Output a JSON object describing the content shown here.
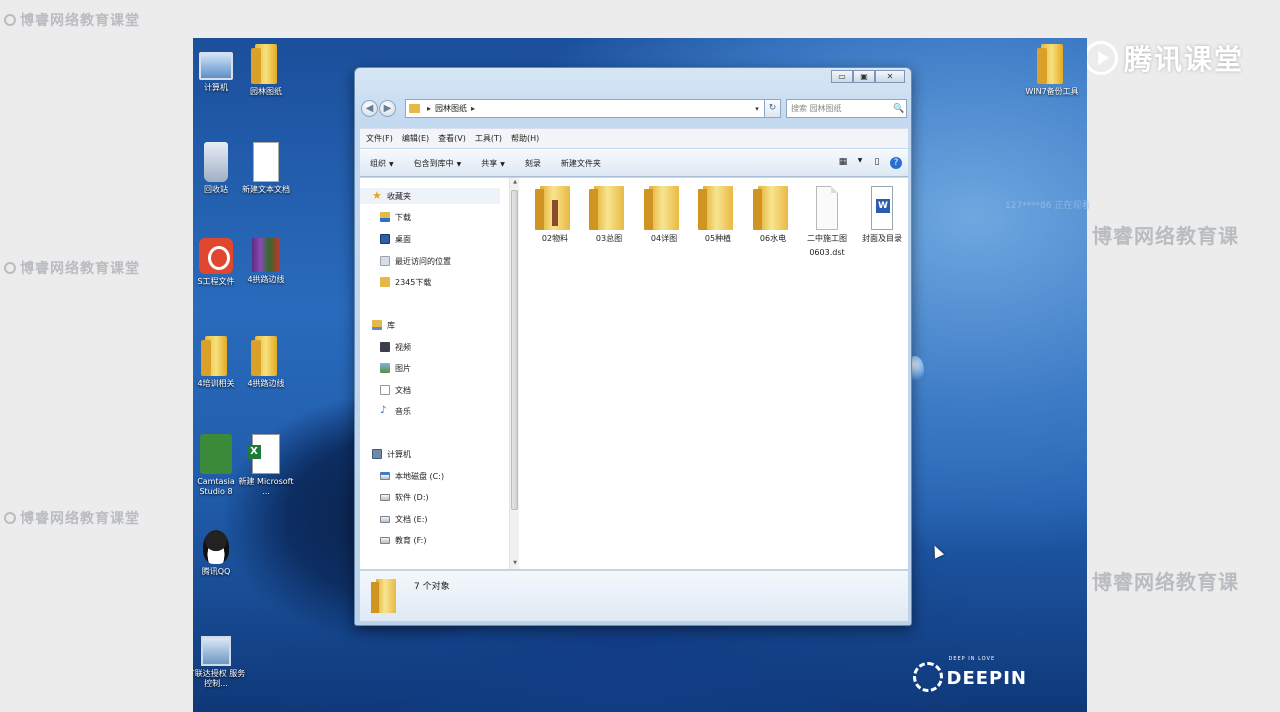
{
  "watermarks": {
    "side": "博睿网络教育课堂",
    "large": "博睿网络教育课",
    "brand": "腾讯课堂",
    "desktop_right": "127****86 正在观看"
  },
  "desktop": {
    "icons": [
      {
        "label": "计算机",
        "icon": "computer-icon"
      },
      {
        "label": "园林图纸",
        "icon": "folder-icon"
      },
      {
        "label": "回收站",
        "icon": "recycle-bin-icon"
      },
      {
        "label": "新建文本文档",
        "icon": "text-document-icon"
      },
      {
        "label": "S工程文件",
        "icon": "red-app-icon"
      },
      {
        "label": "4拱路边线",
        "icon": "winrar-archive-icon"
      },
      {
        "label": "4培训相关",
        "icon": "folder-icon"
      },
      {
        "label": "4拱路边线",
        "icon": "folder-icon"
      },
      {
        "label": "Camtasia Studio 8",
        "icon": "camtasia-icon"
      },
      {
        "label": "新建 Microsoft ...",
        "icon": "excel-icon"
      },
      {
        "label": "腾讯QQ",
        "icon": "qq-penguin-icon"
      },
      {
        "label": "广联达授权 服务控制...",
        "icon": "network-icon"
      },
      {
        "label": "WIN7备份工具",
        "icon": "folder-icon"
      }
    ],
    "logo_small": "DEEP IN LOVE",
    "logo": "DEEPIN"
  },
  "window": {
    "caption": {
      "minimize": "▭",
      "maximize": "▣",
      "close": "✕"
    },
    "nav": {
      "back": "◀",
      "forward": "▶"
    },
    "address": {
      "path": "园林图纸",
      "sep": "▸",
      "dropdown": "▾",
      "refresh": "↻"
    },
    "search": {
      "placeholder": "搜索 园林图纸",
      "icon": "🔍"
    },
    "menu": [
      "文件(F)",
      "编辑(E)",
      "查看(V)",
      "工具(T)",
      "帮助(H)"
    ],
    "toolbar": {
      "organize": "组织",
      "include": "包含到库中",
      "share": "共享",
      "burn": "刻录",
      "new_folder": "新建文件夹",
      "arrow": "▼",
      "views": "▦",
      "preview": "▯",
      "help": "?"
    },
    "sidebar": {
      "favorites": "收藏夹",
      "fav_items": [
        "下载",
        "桌面",
        "最近访问的位置",
        "2345下载"
      ],
      "library": "库",
      "lib_items": [
        "视频",
        "图片",
        "文档",
        "音乐"
      ],
      "computer": "计算机",
      "drives": [
        "本地磁盘 (C:)",
        "软件 (D:)",
        "文档 (E:)",
        "教育 (F:)"
      ]
    },
    "files": [
      {
        "name": "02物料",
        "type": "folder"
      },
      {
        "name": "03总图",
        "type": "folder"
      },
      {
        "name": "04详图",
        "type": "folder"
      },
      {
        "name": "05种植",
        "type": "folder"
      },
      {
        "name": "06水电",
        "type": "folder"
      },
      {
        "name": "二中施工图 0603.dst",
        "type": "dst-file"
      },
      {
        "name": "封面及目录",
        "type": "word-document"
      }
    ],
    "status": "7 个对象"
  }
}
